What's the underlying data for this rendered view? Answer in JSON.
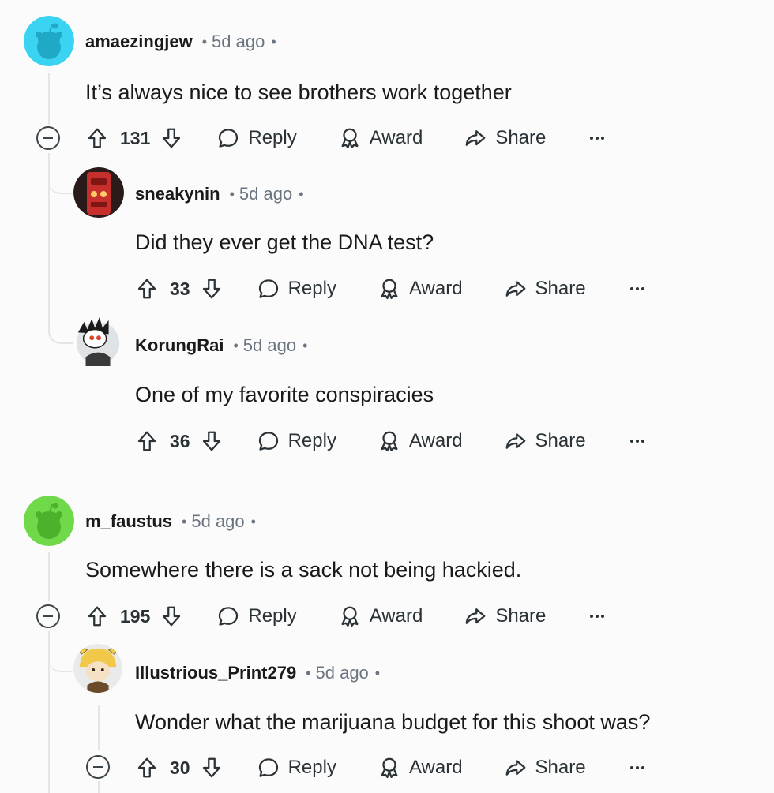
{
  "comments": [
    {
      "username": "amaezingjew",
      "time": "5d ago",
      "text": "It’s always nice to see brothers work together",
      "score": "131",
      "avatar_color": "#3ad3f2",
      "actions": {
        "reply": "Reply",
        "award": "Award",
        "share": "Share"
      }
    },
    {
      "username": "sneakynin",
      "time": "5d ago",
      "text": "Did they ever get the DNA test?",
      "score": "33",
      "avatar_color": "#c62f2b",
      "actions": {
        "reply": "Reply",
        "award": "Award",
        "share": "Share"
      }
    },
    {
      "username": "KorungRai",
      "time": "5d ago",
      "text": "One of my favorite conspiracies",
      "score": "36",
      "avatar_color": "#ffffff",
      "actions": {
        "reply": "Reply",
        "award": "Award",
        "share": "Share"
      }
    },
    {
      "username": "m_faustus",
      "time": "5d ago",
      "text": "Somewhere there is a sack not being hackied.",
      "score": "195",
      "avatar_color": "#6fd94a",
      "actions": {
        "reply": "Reply",
        "award": "Award",
        "share": "Share"
      }
    },
    {
      "username": "Illustrious_Print279",
      "time": "5d ago",
      "text": "Wonder what the marijuana budget for this shoot was?",
      "score": "30",
      "avatar_color": "#f2c84b",
      "actions": {
        "reply": "Reply",
        "award": "Award",
        "share": "Share"
      }
    }
  ]
}
